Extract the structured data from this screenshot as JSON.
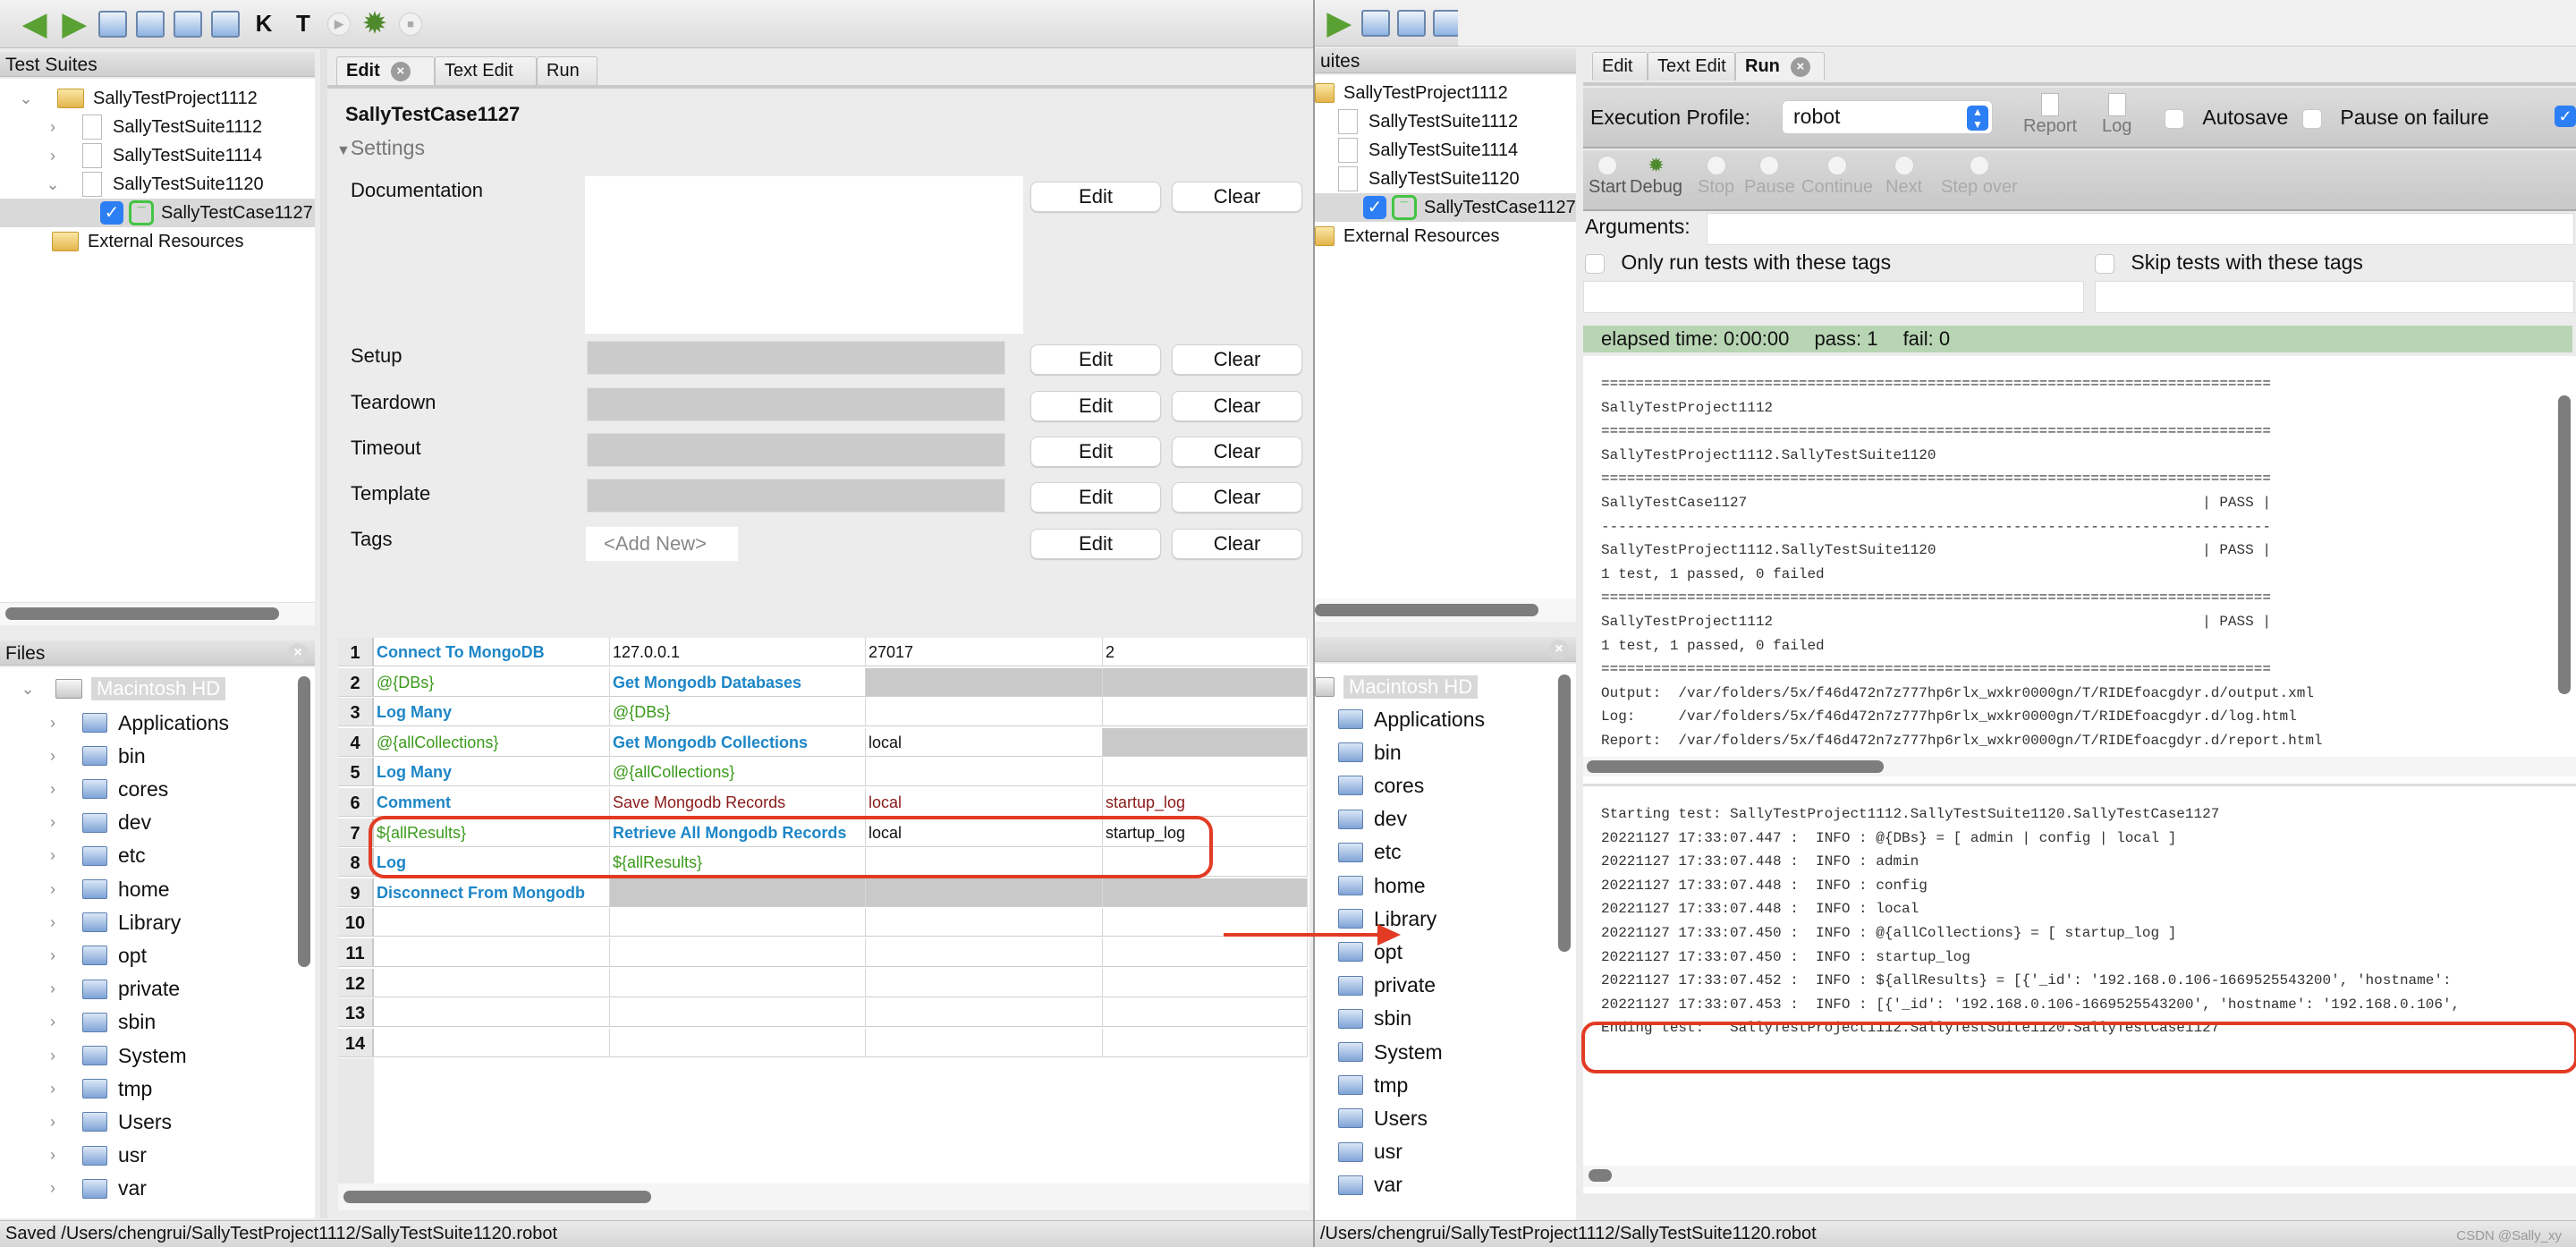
{
  "left_window": {
    "toolbar": {
      "icons": [
        "back-arrow",
        "forward-arrow",
        "new-project",
        "open",
        "save",
        "save-all",
        "search-keywords",
        "search-tests",
        "run",
        "debug",
        "stop"
      ]
    },
    "test_suites": {
      "header": "Test Suites",
      "items": [
        {
          "label": "SallyTestProject1112",
          "type": "project",
          "expanded": true
        },
        {
          "label": "SallyTestSuite1112",
          "type": "suite",
          "expanded": false
        },
        {
          "label": "SallyTestSuite1114",
          "type": "suite",
          "expanded": false
        },
        {
          "label": "SallyTestSuite1120",
          "type": "suite",
          "expanded": true
        },
        {
          "label": "SallyTestCase1127",
          "type": "testcase",
          "checked": true,
          "selected": true
        },
        {
          "label": "External Resources",
          "type": "resources"
        }
      ]
    },
    "files": {
      "header": "Files",
      "root": "Macintosh HD",
      "items": [
        "Applications",
        "bin",
        "cores",
        "dev",
        "etc",
        "home",
        "Library",
        "opt",
        "private",
        "sbin",
        "System",
        "tmp",
        "Users",
        "usr",
        "var"
      ]
    },
    "tabs": [
      {
        "label": "Edit",
        "active": true
      },
      {
        "label": "Text Edit",
        "active": false
      },
      {
        "label": "Run",
        "active": false
      }
    ],
    "editor": {
      "title": "SallyTestCase1127",
      "settings_label": "Settings",
      "settings": [
        {
          "label": "Documentation",
          "value": "",
          "edit": "Edit",
          "clear": "Clear"
        },
        {
          "label": "Setup",
          "value": "",
          "edit": "Edit",
          "clear": "Clear"
        },
        {
          "label": "Teardown",
          "value": "",
          "edit": "Edit",
          "clear": "Clear"
        },
        {
          "label": "Timeout",
          "value": "",
          "edit": "Edit",
          "clear": "Clear"
        },
        {
          "label": "Template",
          "value": "",
          "edit": "Edit",
          "clear": "Clear"
        },
        {
          "label": "Tags",
          "value": "<Add New>",
          "edit": "Edit",
          "clear": "Clear"
        }
      ],
      "grid_rows": [
        {
          "num": "1",
          "cells": [
            "Connect To MongoDB",
            "127.0.0.1",
            "27017",
            "2"
          ],
          "styles": [
            "kw",
            "plain",
            "plain",
            "plain"
          ]
        },
        {
          "num": "2",
          "cells": [
            "@{DBs}",
            "Get Mongodb Databases",
            "",
            ""
          ],
          "styles": [
            "var",
            "kw",
            "gray",
            "gray"
          ]
        },
        {
          "num": "3",
          "cells": [
            "Log Many",
            "@{DBs}",
            "",
            ""
          ],
          "styles": [
            "kw",
            "var",
            "plain",
            "plain"
          ]
        },
        {
          "num": "4",
          "cells": [
            "@{allCollections}",
            "Get Mongodb Collections",
            "local",
            ""
          ],
          "styles": [
            "var",
            "kw",
            "plain",
            "gray"
          ]
        },
        {
          "num": "5",
          "cells": [
            "Log Many",
            "@{allCollections}",
            "",
            ""
          ],
          "styles": [
            "kw",
            "var",
            "plain",
            "plain"
          ]
        },
        {
          "num": "6",
          "cells": [
            "Comment",
            "Save Mongodb Records",
            "local",
            "startup_log"
          ],
          "styles": [
            "kw",
            "cm",
            "cm",
            "cm"
          ]
        },
        {
          "num": "7",
          "cells": [
            "${allResults}",
            "Retrieve All Mongodb Records",
            "local",
            "startup_log"
          ],
          "styles": [
            "var",
            "kw",
            "plain",
            "plain"
          ]
        },
        {
          "num": "8",
          "cells": [
            "Log",
            "${allResults}",
            "",
            ""
          ],
          "styles": [
            "kw",
            "var",
            "plain",
            "plain"
          ]
        },
        {
          "num": "9",
          "cells": [
            "Disconnect From Mongodb",
            "",
            "",
            ""
          ],
          "styles": [
            "kw",
            "gray",
            "gray",
            "gray"
          ]
        },
        {
          "num": "10",
          "cells": [
            "",
            "",
            "",
            ""
          ],
          "styles": [
            "plain",
            "plain",
            "plain",
            "plain"
          ]
        },
        {
          "num": "11",
          "cells": [
            "",
            "",
            "",
            ""
          ],
          "styles": [
            "plain",
            "plain",
            "plain",
            "plain"
          ]
        },
        {
          "num": "12",
          "cells": [
            "",
            "",
            "",
            ""
          ],
          "styles": [
            "plain",
            "plain",
            "plain",
            "plain"
          ]
        },
        {
          "num": "13",
          "cells": [
            "",
            "",
            "",
            ""
          ],
          "styles": [
            "plain",
            "plain",
            "plain",
            "plain"
          ]
        },
        {
          "num": "14",
          "cells": [
            "",
            "",
            "",
            ""
          ],
          "styles": [
            "plain",
            "plain",
            "plain",
            "plain"
          ]
        }
      ]
    },
    "status": "Saved /Users/chengrui/SallyTestProject1112/SallyTestSuite1120.robot"
  },
  "right_window": {
    "tree_header_partial": "uites",
    "tree_items": [
      {
        "label": "SallyTestProject1112",
        "type": "project"
      },
      {
        "label": "SallyTestSuite1112",
        "type": "suite"
      },
      {
        "label": "SallyTestSuite1114",
        "type": "suite"
      },
      {
        "label": "SallyTestSuite1120",
        "type": "suite"
      },
      {
        "label": "SallyTestCase1127",
        "type": "testcase",
        "checked": true
      },
      {
        "label": "External Resources",
        "type": "resources"
      }
    ],
    "files": {
      "root": "Macintosh HD",
      "items": [
        "Applications",
        "bin",
        "cores",
        "dev",
        "etc",
        "home",
        "Library",
        "opt",
        "private",
        "sbin",
        "System",
        "tmp",
        "Users",
        "usr",
        "var"
      ]
    },
    "tabs": [
      {
        "label": "Edit",
        "active": false
      },
      {
        "label": "Text Edit",
        "active": false
      },
      {
        "label": "Run",
        "active": true
      }
    ],
    "run": {
      "execution_profile_label": "Execution Profile:",
      "execution_profile_value": "robot",
      "report_label": "Report",
      "log_label": "Log",
      "autosave_label": "Autosave",
      "autosave_checked": false,
      "pause_on_failure_label": "Pause on failure",
      "pause_on_failure_checked": false,
      "extra_checkbox_checked": true,
      "buttons": [
        {
          "label": "Start",
          "enabled": true
        },
        {
          "label": "Debug",
          "enabled": true
        },
        {
          "label": "Stop",
          "enabled": false
        },
        {
          "label": "Pause",
          "enabled": false
        },
        {
          "label": "Continue",
          "enabled": false
        },
        {
          "label": "Next",
          "enabled": false
        },
        {
          "label": "Step over",
          "enabled": false
        }
      ],
      "arguments_label": "Arguments:",
      "arguments_value": "",
      "only_run_tags_label": "Only run tests with these tags",
      "skip_tags_label": "Skip tests with these tags",
      "summary": {
        "elapsed": "elapsed time: 0:00:00",
        "pass": "pass: 1",
        "fail": "fail: 0"
      },
      "console_lines": [
        "==============================================================================",
        "SallyTestProject1112",
        "==============================================================================",
        "SallyTestProject1112.SallyTestSuite1120",
        "==============================================================================",
        "SallyTestCase1127                                                     | PASS |",
        "------------------------------------------------------------------------------",
        "SallyTestProject1112.SallyTestSuite1120                               | PASS |",
        "1 test, 1 passed, 0 failed",
        "==============================================================================",
        "SallyTestProject1112                                                  | PASS |",
        "1 test, 1 passed, 0 failed",
        "==============================================================================",
        "Output:  /var/folders/5x/f46d472n7z777hp6rlx_wxkr0000gn/T/RIDEfoacgdyr.d/output.xml",
        "Log:     /var/folders/5x/f46d472n7z777hp6rlx_wxkr0000gn/T/RIDEfoacgdyr.d/log.html",
        "Report:  /var/folders/5x/f46d472n7z777hp6rlx_wxkr0000gn/T/RIDEfoacgdyr.d/report.html"
      ],
      "log_lines": [
        "Starting test: SallyTestProject1112.SallyTestSuite1120.SallyTestCase1127",
        "20221127 17:33:07.447 :  INFO : @{DBs} = [ admin | config | local ]",
        "20221127 17:33:07.448 :  INFO : admin",
        "20221127 17:33:07.448 :  INFO : config",
        "20221127 17:33:07.448 :  INFO : local",
        "20221127 17:33:07.450 :  INFO : @{allCollections} = [ startup_log ]",
        "20221127 17:33:07.450 :  INFO : startup_log",
        "20221127 17:33:07.452 :  INFO : ${allResults} = [{'_id': '192.168.0.106-1669525543200', 'hostname':",
        "20221127 17:33:07.453 :  INFO : [{'_id': '192.168.0.106-1669525543200', 'hostname': '192.168.0.106',",
        "Ending test:   SallyTestProject1112.SallyTestSuite1120.SallyTestCase1127"
      ]
    },
    "status": "/Users/chengrui/SallyTestProject1112/SallyTestSuite1120.robot",
    "watermark": "CSDN @Sally_xy"
  },
  "annotations": {
    "color": "#e23b24"
  }
}
